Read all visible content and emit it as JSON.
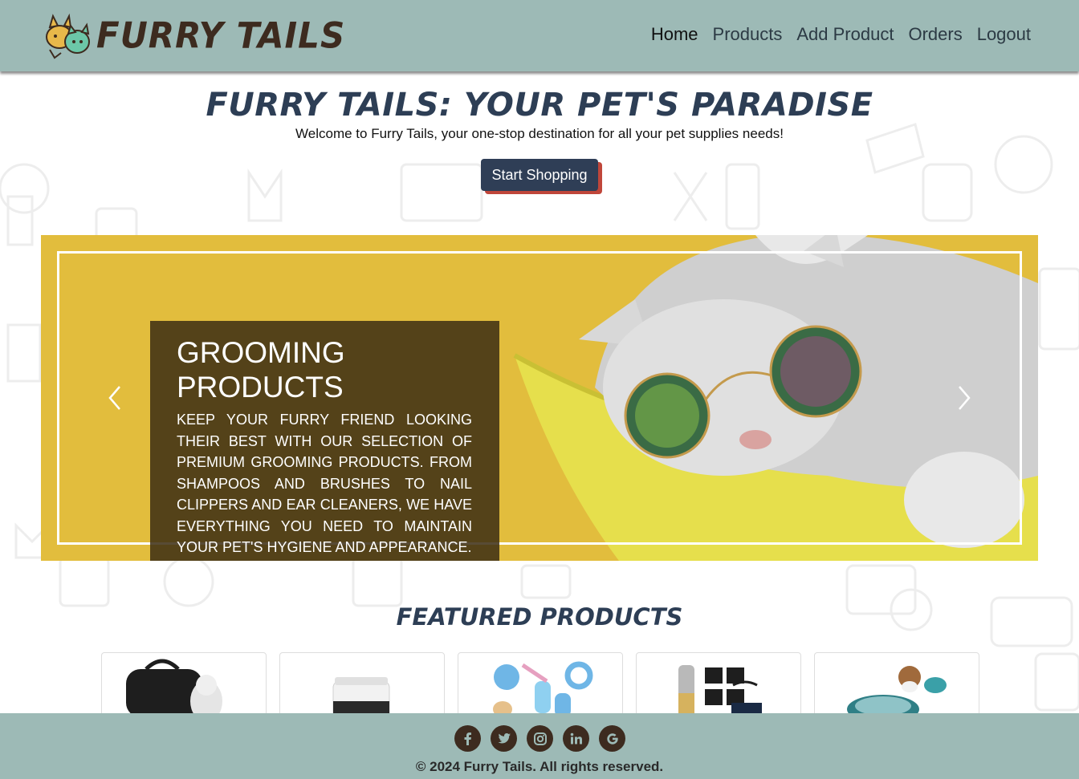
{
  "brand": {
    "name": "FURRY TAILS"
  },
  "nav": {
    "items": [
      {
        "label": "Home"
      },
      {
        "label": "Products"
      },
      {
        "label": "Add Product"
      },
      {
        "label": "Orders"
      },
      {
        "label": "Logout"
      }
    ]
  },
  "hero": {
    "title": "FURRY TAILS: YOUR PET'S PARADISE",
    "subtitle": "Welcome to Furry Tails, your one-stop destination for all your pet supplies needs!",
    "cta_label": "Start Shopping"
  },
  "carousel": {
    "slide_title": "GROOMING PRODUCTS",
    "slide_text": "KEEP YOUR FURRY FRIEND LOOKING THEIR BEST WITH OUR SELECTION OF PREMIUM GROOMING PRODUCTS. FROM SHAMPOOS AND BRUSHES TO NAIL CLIPPERS AND EAR CLEANERS, WE HAVE EVERYTHING YOU NEED TO MAINTAIN YOUR PET'S HYGIENE AND APPEARANCE."
  },
  "featured": {
    "title": "FEATURED PRODUCTS",
    "products": [
      {
        "icon": "pet-carrier-icon"
      },
      {
        "icon": "supplement-jar-icon"
      },
      {
        "icon": "dog-toys-icon"
      },
      {
        "icon": "hair-clipper-kit-icon"
      },
      {
        "icon": "pet-bowl-icon"
      }
    ]
  },
  "footer": {
    "social": [
      "facebook-icon",
      "twitter-icon",
      "instagram-icon",
      "linkedin-icon",
      "google-icon"
    ],
    "copyright": "© 2024 Furry Tails. All rights reserved."
  },
  "colors": {
    "nav_bg": "#9dbab6",
    "brand_dark": "#3d2b1f",
    "heading": "#2d3e55",
    "cta_bg": "#2f3e56",
    "cta_shadow": "#c0463a",
    "carousel_bg": "#e2bd3d"
  }
}
